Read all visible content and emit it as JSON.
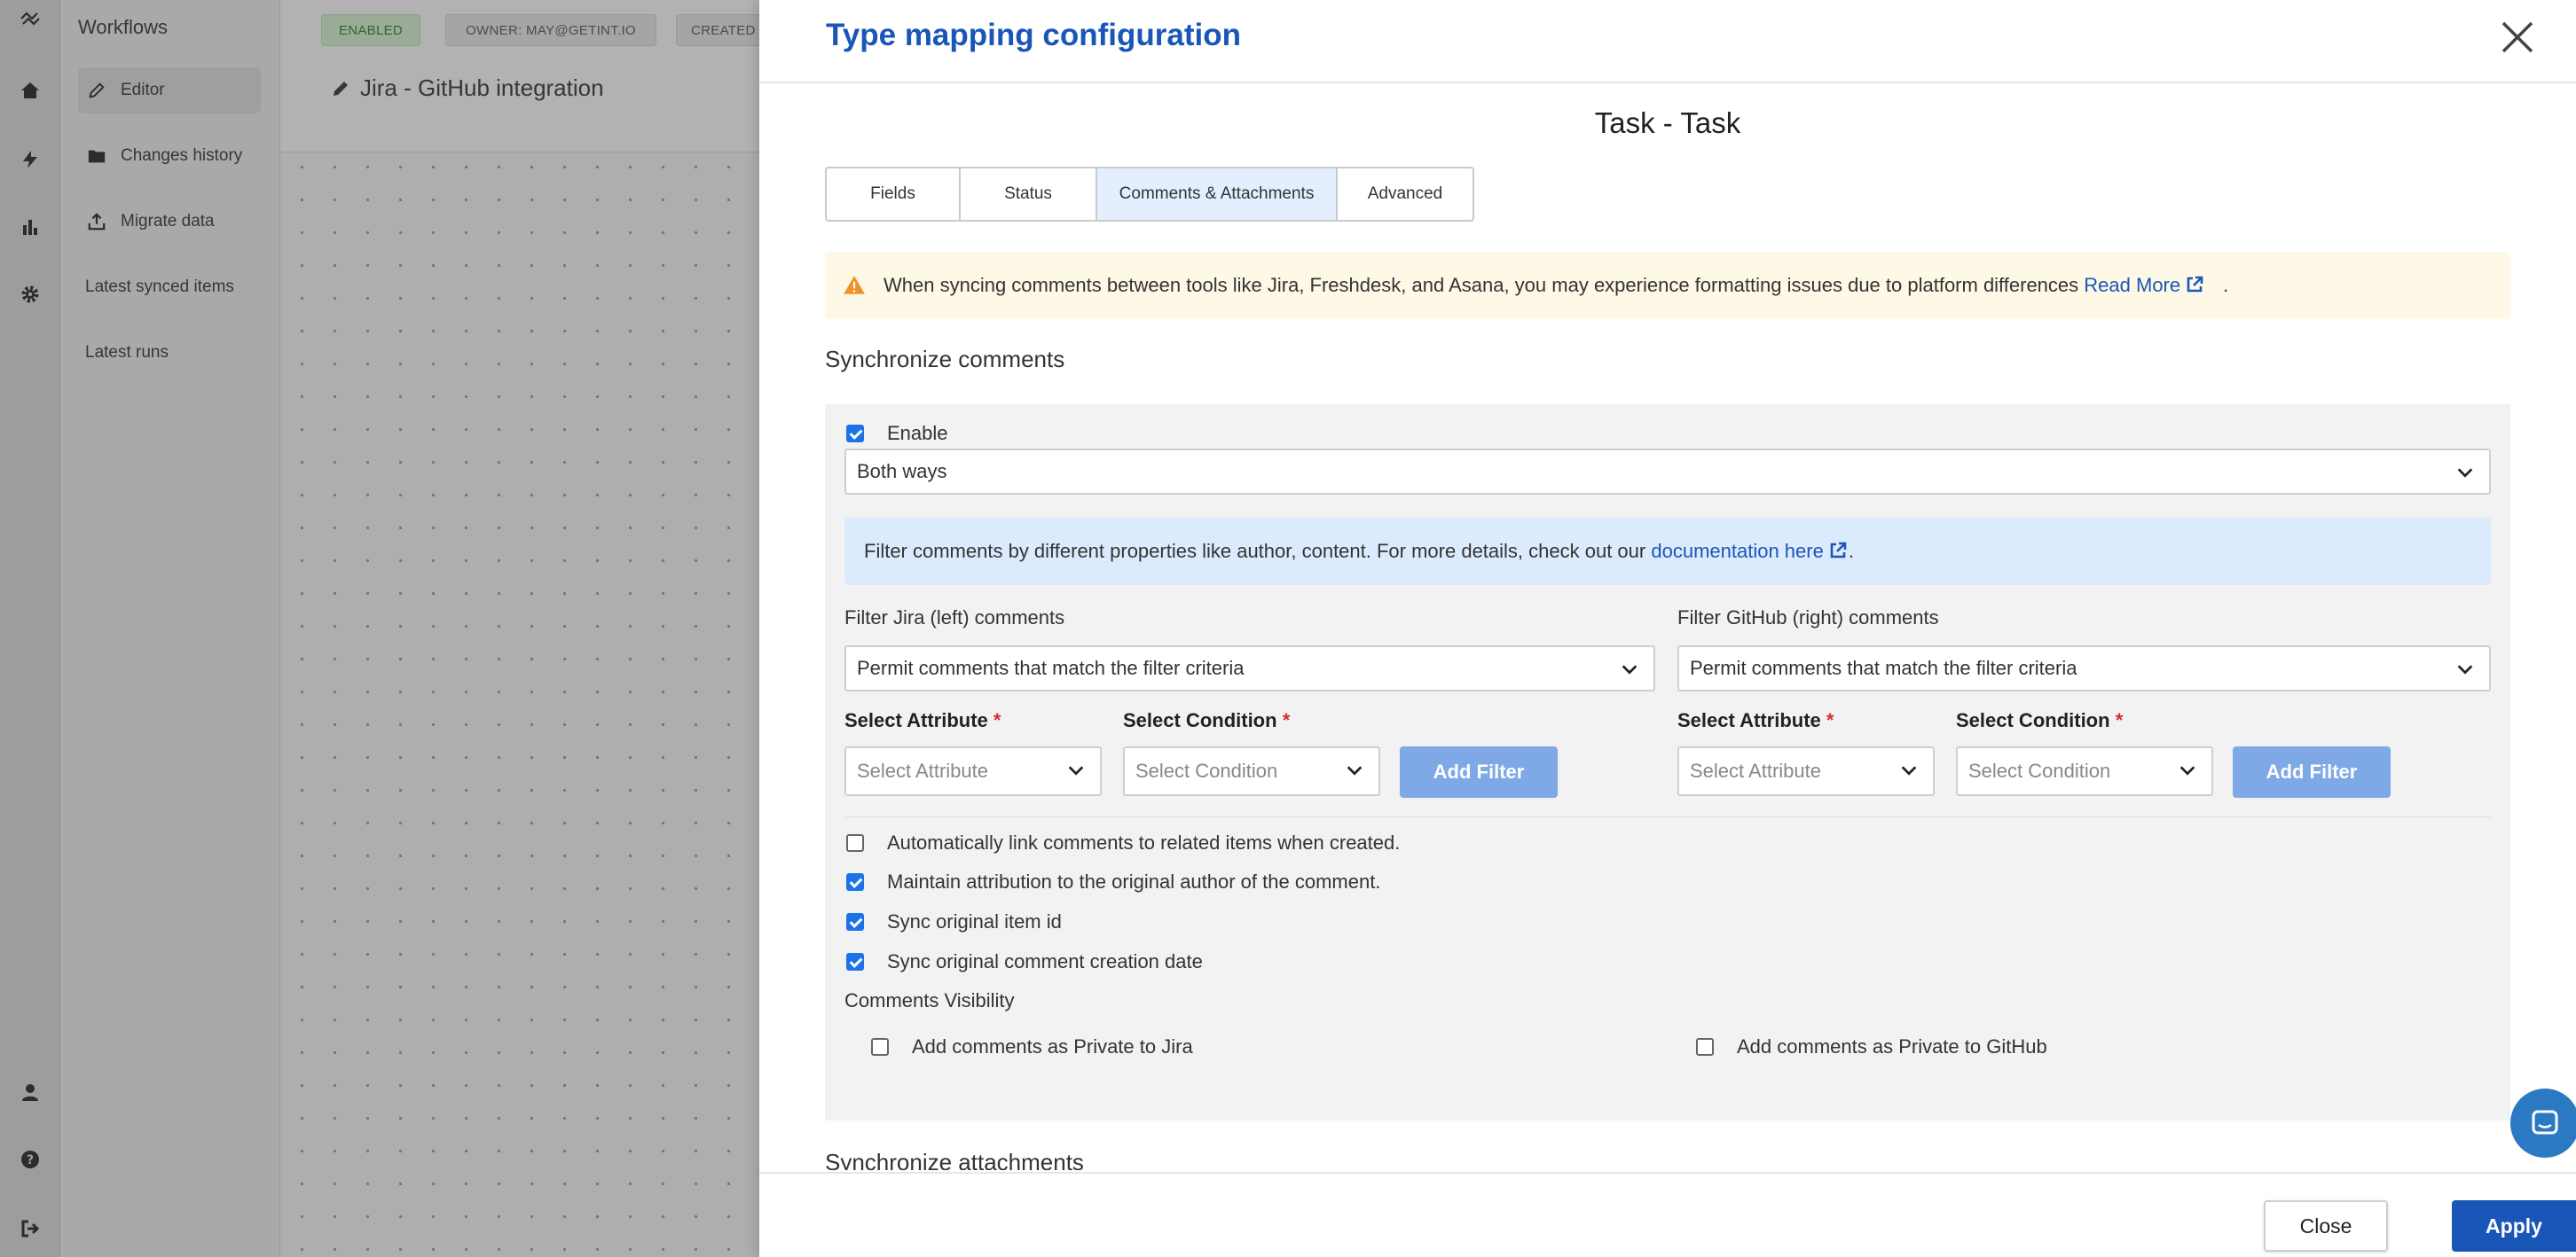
{
  "app": {
    "nav_title": "Workflows",
    "nav_items": [
      {
        "label": "Editor",
        "icon": "pencil-icon"
      },
      {
        "label": "Changes history",
        "icon": "folder-icon"
      },
      {
        "label": "Migrate data",
        "icon": "upload-icon"
      },
      {
        "label": "Latest synced items"
      },
      {
        "label": "Latest runs"
      }
    ],
    "badges": {
      "status": "ENABLED",
      "owner": "OWNER: MAY@GETINT.IO",
      "created": "CREATED"
    },
    "workflow_title": "Jira - GitHub integration"
  },
  "panel": {
    "title": "Type mapping configuration",
    "type_title": "Task - Task",
    "tabs": [
      "Fields",
      "Status",
      "Comments & Attachments",
      "Advanced"
    ],
    "active_tab": "Comments & Attachments",
    "warning": {
      "text": "When syncing comments between tools like Jira, Freshdesk, and Asana, you may experience formatting issues due to platform differences",
      "link": "Read More",
      "suffix": "."
    },
    "sync_comments": {
      "title": "Synchronize comments",
      "enable_label": "Enable",
      "direction": "Both ways",
      "info": {
        "text": "Filter comments by different properties like author, content. For more details, check out our",
        "link": "documentation here",
        "suffix": "."
      },
      "left": {
        "label": "Filter Jira (left) comments",
        "mode": "Permit comments that match the filter criteria",
        "attr_label": "Select Attribute",
        "attr_placeholder": "Select Attribute",
        "cond_label": "Select Condition",
        "cond_placeholder": "Select Condition",
        "add_filter": "Add Filter"
      },
      "right": {
        "label": "Filter GitHub (right) comments",
        "mode": "Permit comments that match the filter criteria",
        "attr_label": "Select Attribute",
        "attr_placeholder": "Select Attribute",
        "cond_label": "Select Condition",
        "cond_placeholder": "Select Condition",
        "add_filter": "Add Filter"
      },
      "required_mark": "*",
      "options": [
        {
          "label": "Automatically link comments to related items when created.",
          "checked": false
        },
        {
          "label": "Maintain attribution to the original author of the comment.",
          "checked": true
        },
        {
          "label": "Sync original item id",
          "checked": true
        },
        {
          "label": "Sync original comment creation date",
          "checked": true
        }
      ],
      "visibility_label": "Comments Visibility",
      "private_jira": "Add comments as Private to Jira",
      "private_github": "Add comments as Private to GitHub"
    },
    "sync_attachments_title": "Synchronize attachments",
    "close_label": "Close",
    "apply_label": "Apply"
  },
  "colors": {
    "accent": "#1a56b8",
    "checkbox": "#1a73e8",
    "warn_bg": "#fef8e6",
    "info_bg": "#dceafd",
    "add_filter": "#7fa8e6"
  }
}
